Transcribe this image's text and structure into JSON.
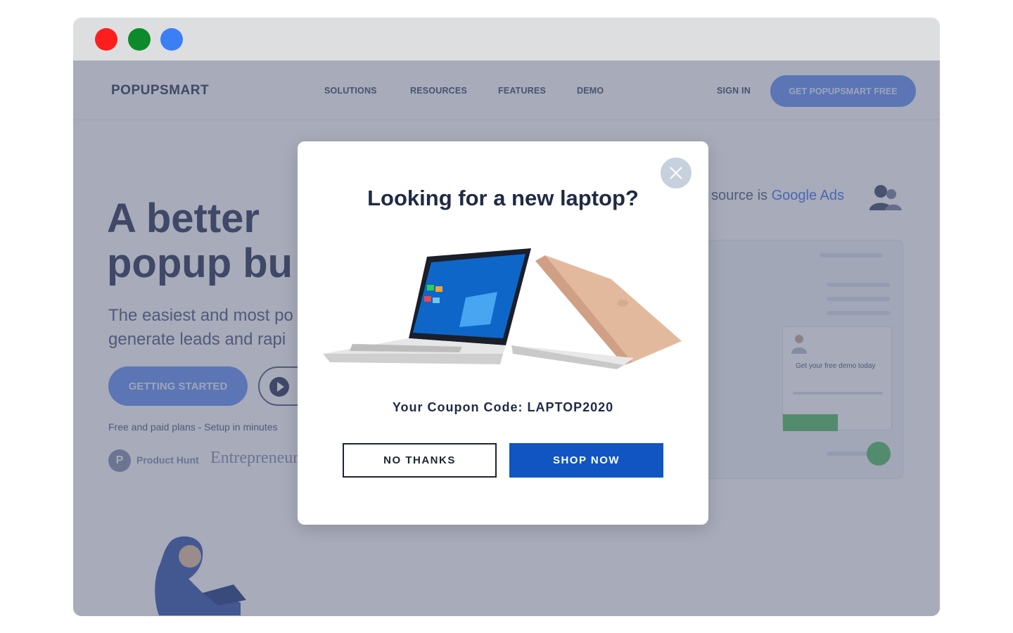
{
  "window": {
    "controls": {
      "close_color": "#ff1e1e",
      "minimize_color": "#0d8a2b",
      "maximize_color": "#3b7ff5"
    }
  },
  "nav": {
    "logo": "POPUPSMART",
    "links": [
      "SOLUTIONS",
      "RESOURCES",
      "FEATURES",
      "DEMO"
    ],
    "sign_in": "SIGN IN",
    "cta": "GET POPUPSMART FREE"
  },
  "hero": {
    "title_line1": "A better",
    "title_line2": "popup bu",
    "subtitle_line1": "The easiest and most po",
    "subtitle_line2": "generate leads and rapi",
    "start_button": "GETTING STARTED",
    "free_plans": "Free and paid plans - Setup in minutes",
    "producthunt_label": "Product Hunt",
    "entrepreneur_label": "Entrepreneur"
  },
  "side_widget": {
    "source_prefix": "source is ",
    "source_highlight": "Google Ads",
    "demo_title": "Get your free demo today",
    "highlight_color": "#4c7ff0"
  },
  "popup": {
    "title": "Looking for a new laptop?",
    "coupon": "Your Coupon Code: LAPTOP2020",
    "no_thanks": "NO THANKS",
    "shop_now": "SHOP NOW",
    "shop_color": "#1055c2",
    "close_icon": "close-icon",
    "image": "laptops-image"
  }
}
